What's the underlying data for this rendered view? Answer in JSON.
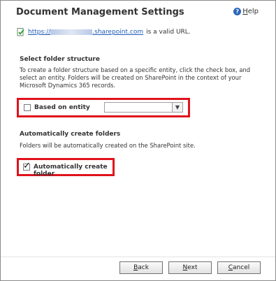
{
  "dialog": {
    "title": "Document Management Settings",
    "help": {
      "prefix_underlined": "H",
      "rest": "elp"
    }
  },
  "url_row": {
    "link_prefix": "https://",
    "link_suffix": ".sharepoint.com",
    "message": "is a valid URL."
  },
  "folder_structure": {
    "heading": "Select folder structure",
    "description": "To create a folder structure based on a specific entity, click the check box, and select an entity. Folders will be created on SharePoint in the context of your Microsoft Dynamics 365 records.",
    "checkbox_label": "Based on entity",
    "checked": false,
    "entity_select_value": ""
  },
  "auto_folders": {
    "heading": "Automatically create folders",
    "description": "Folders will be automatically created on the SharePoint site.",
    "checkbox_label": "Automatically create folder",
    "checked": true
  },
  "buttons": {
    "back": {
      "u": "B",
      "rest": "ack"
    },
    "next": {
      "u": "N",
      "rest": "ext"
    },
    "cancel": {
      "u": "C",
      "rest": "ancel"
    }
  },
  "colors": {
    "highlight_border": "#e0121c",
    "link": "#1f5ab8",
    "help_icon": "#2a66b8"
  },
  "icons": {
    "url_status": "valid-url-check-icon",
    "help": "help-icon",
    "dropdown": "chevron-down-icon"
  }
}
